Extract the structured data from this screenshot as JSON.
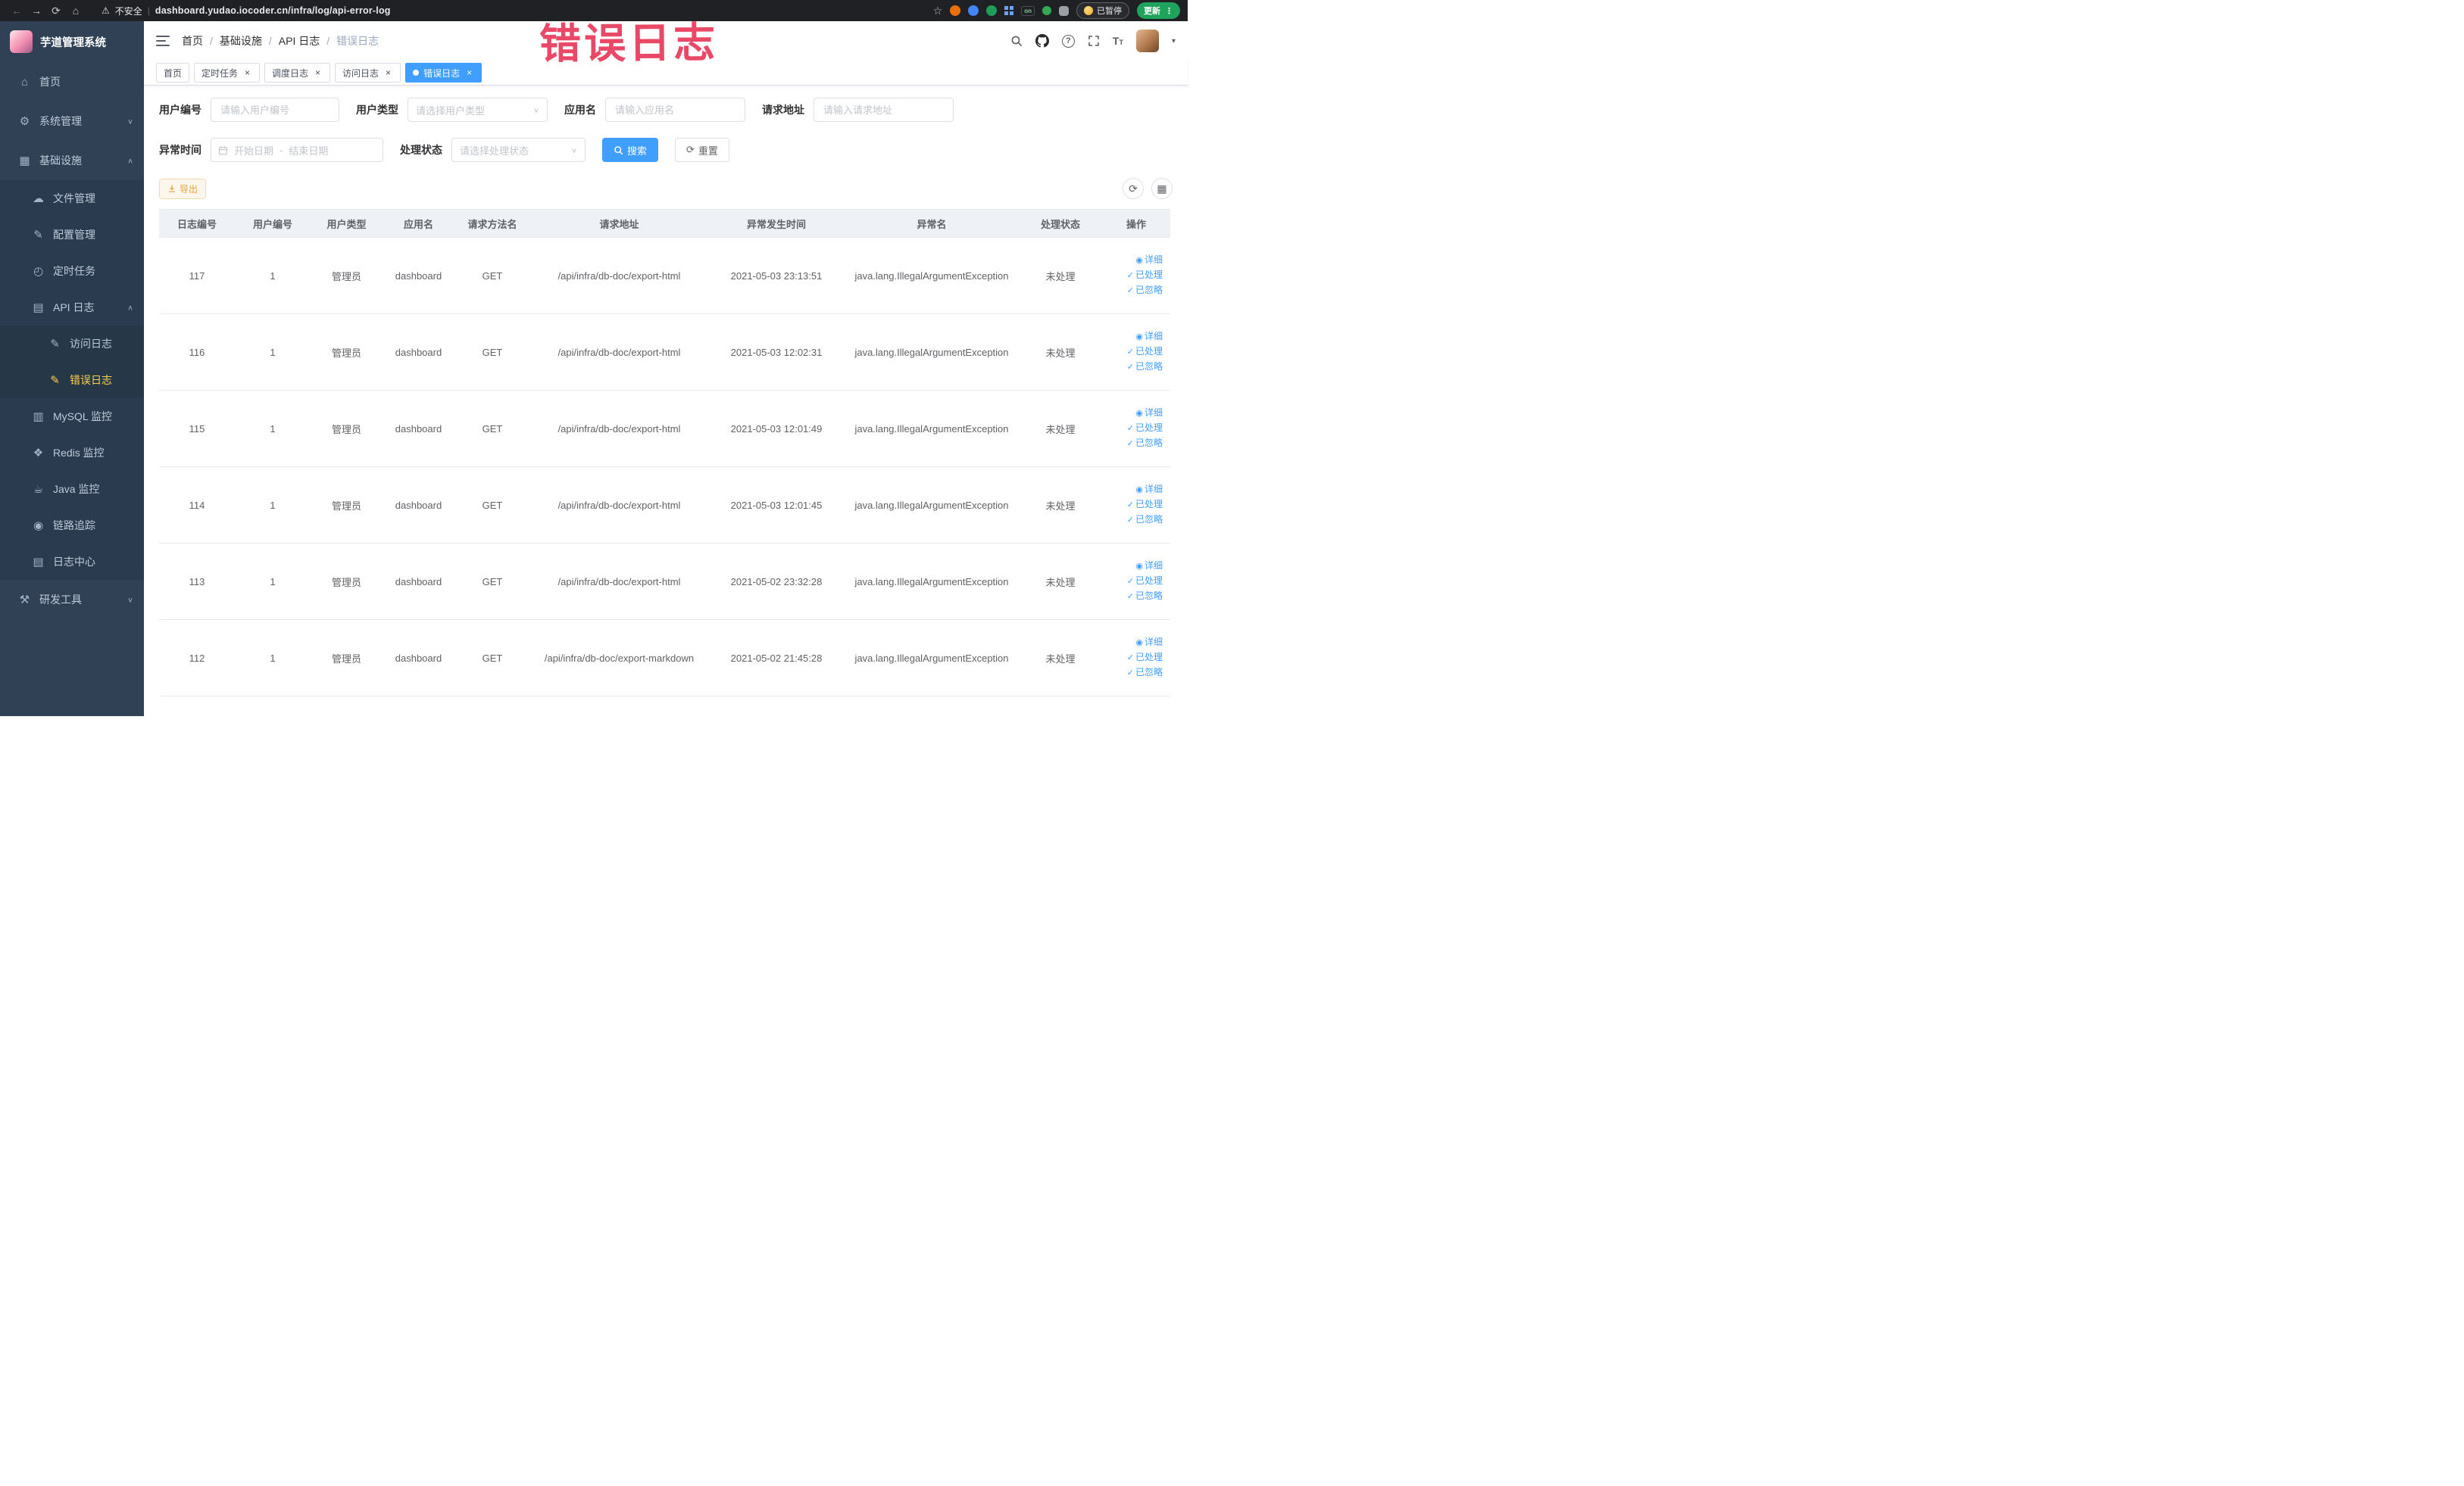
{
  "colors": {
    "accent_blue": "#409eff",
    "sidebar_bg": "#304156",
    "sidebar_active_yellow": "#ffd04b",
    "annotation_red": "#ea4867",
    "warning_orange": "#e6a23c",
    "table_header_bg": "#eef1f6",
    "browser_bar_bg": "#202124",
    "update_green": "#1fa35c"
  },
  "icons": {
    "back": "←",
    "forward": "→",
    "reload": "⟳",
    "home": "⌂",
    "warning": "⚠",
    "star": "☆",
    "close": "×",
    "menu_dots": "⋮",
    "crumb_sep": "/",
    "help": "?",
    "font_size": "T",
    "caret_down": "▾",
    "refresh": "⟳",
    "columns": "▦",
    "reset": "⟳",
    "date_sep": "-"
  },
  "browser": {
    "warning_label": "不安全",
    "url": "dashboard.yudao.iocoder.cn/infra/log/api-error-log",
    "ext_on": "on",
    "paused_label": "已暂停",
    "update_label": "更新"
  },
  "annotation": "错误日志",
  "sidebar": {
    "title": "芋道管理系统",
    "items": [
      {
        "label": "首页",
        "icon": "⌂"
      },
      {
        "label": "系统管理",
        "icon": "⚙",
        "chevron": "∨"
      },
      {
        "label": "基础设施",
        "icon": "▦",
        "chevron": "∧"
      },
      {
        "label": "文件管理",
        "icon": "☁"
      },
      {
        "label": "配置管理",
        "icon": "✎"
      },
      {
        "label": "定时任务",
        "icon": "◴"
      },
      {
        "label": "API 日志",
        "icon": "▤",
        "chevron": "∧"
      },
      {
        "label": "访问日志",
        "icon": "✎"
      },
      {
        "label": "错误日志",
        "icon": "✎"
      },
      {
        "label": "MySQL 监控",
        "icon": "▥"
      },
      {
        "label": "Redis 监控",
        "icon": "❖"
      },
      {
        "label": "Java 监控",
        "icon": "☕"
      },
      {
        "label": "链路追踪",
        "icon": "◉"
      },
      {
        "label": "日志中心",
        "icon": "▤"
      },
      {
        "label": "研发工具",
        "icon": "⚒",
        "chevron": "∨"
      }
    ]
  },
  "breadcrumb": [
    "首页",
    "基础设施",
    "API 日志",
    "错误日志"
  ],
  "tabs": [
    {
      "label": "首页"
    },
    {
      "label": "定时任务"
    },
    {
      "label": "调度日志"
    },
    {
      "label": "访问日志"
    },
    {
      "label": "错误日志"
    }
  ],
  "filters": {
    "user_id_label": "用户编号",
    "user_id_placeholder": "请输入用户编号",
    "user_type_label": "用户类型",
    "user_type_placeholder": "请选择用户类型",
    "app_label": "应用名",
    "app_placeholder": "请输入应用名",
    "url_label": "请求地址",
    "url_placeholder": "请输入请求地址",
    "time_label": "异常时间",
    "time_start": "开始日期",
    "time_end": "结束日期",
    "status_label": "处理状态",
    "status_placeholder": "请选择处理状态",
    "search": "搜索",
    "reset": "重置"
  },
  "toolbar": {
    "export": "导出"
  },
  "table": {
    "columns": [
      "日志编号",
      "用户编号",
      "用户类型",
      "应用名",
      "请求方法名",
      "请求地址",
      "异常发生时间",
      "异常名",
      "处理状态",
      "操作"
    ],
    "actions": {
      "detail": "详细",
      "done": "已处理",
      "ignore": "已忽略"
    },
    "action_icons": {
      "detail": "◉",
      "done": "✓",
      "ignore": "✓"
    },
    "rows": [
      {
        "id": "117",
        "user_id": "1",
        "user_type": "管理员",
        "app": "dashboard",
        "method": "GET",
        "url": "/api/infra/db-doc/export-html",
        "time": "2021-05-03 23:13:51",
        "exception": "java.lang.IllegalArgumentException",
        "status": "未处理"
      },
      {
        "id": "116",
        "user_id": "1",
        "user_type": "管理员",
        "app": "dashboard",
        "method": "GET",
        "url": "/api/infra/db-doc/export-html",
        "time": "2021-05-03 12:02:31",
        "exception": "java.lang.IllegalArgumentException",
        "status": "未处理"
      },
      {
        "id": "115",
        "user_id": "1",
        "user_type": "管理员",
        "app": "dashboard",
        "method": "GET",
        "url": "/api/infra/db-doc/export-html",
        "time": "2021-05-03 12:01:49",
        "exception": "java.lang.IllegalArgumentException",
        "status": "未处理"
      },
      {
        "id": "114",
        "user_id": "1",
        "user_type": "管理员",
        "app": "dashboard",
        "method": "GET",
        "url": "/api/infra/db-doc/export-html",
        "time": "2021-05-03 12:01:45",
        "exception": "java.lang.IllegalArgumentException",
        "status": "未处理"
      },
      {
        "id": "113",
        "user_id": "1",
        "user_type": "管理员",
        "app": "dashboard",
        "method": "GET",
        "url": "/api/infra/db-doc/export-html",
        "time": "2021-05-02 23:32:28",
        "exception": "java.lang.IllegalArgumentException",
        "status": "未处理"
      },
      {
        "id": "112",
        "user_id": "1",
        "user_type": "管理员",
        "app": "dashboard",
        "method": "GET",
        "url": "/api/infra/db-doc/export-markdown",
        "time": "2021-05-02 21:45:28",
        "exception": "java.lang.IllegalArgumentException",
        "status": "未处理"
      }
    ]
  }
}
